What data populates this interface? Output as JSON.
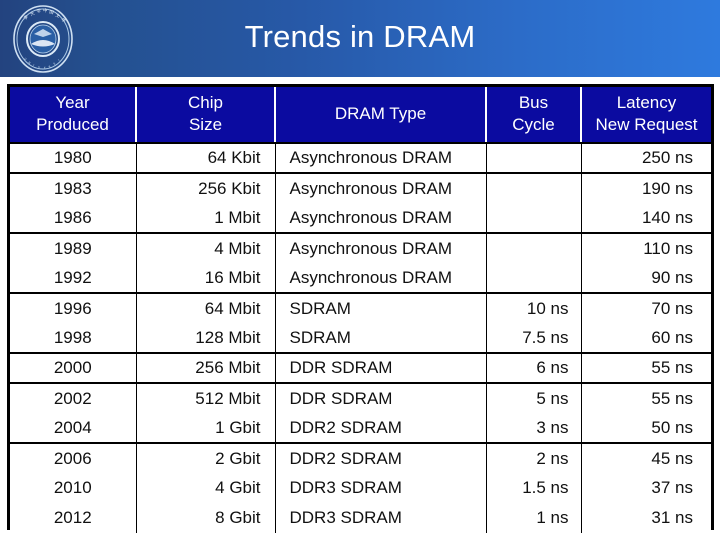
{
  "slide": {
    "title": "Trends in DRAM",
    "logo_name": "university-seal-logo",
    "banner_color_left": "#23437f",
    "banner_color_right": "#2e7ade",
    "table_header_color": "#0b0ba0"
  },
  "table": {
    "columns": [
      {
        "id": "year",
        "line1": "Year",
        "line2": "Produced"
      },
      {
        "id": "chip",
        "line1": "Chip",
        "line2": "Size"
      },
      {
        "id": "type",
        "line1": "DRAM Type",
        "line2": ""
      },
      {
        "id": "bus",
        "line1": "Bus",
        "line2": "Cycle"
      },
      {
        "id": "latency",
        "line1": "Latency",
        "line2": "New Request"
      }
    ],
    "rows": [
      {
        "year": "1980",
        "chip": "64 Kbit",
        "type": "Asynchronous DRAM",
        "bus": "",
        "latency": "250 ns",
        "rule": "strong"
      },
      {
        "year": "1983",
        "chip": "256 Kbit",
        "type": "Asynchronous DRAM",
        "bus": "",
        "latency": "190 ns",
        "rule": "thin"
      },
      {
        "year": "1986",
        "chip": "1 Mbit",
        "type": "Asynchronous DRAM",
        "bus": "",
        "latency": "140 ns",
        "rule": "strong"
      },
      {
        "year": "1989",
        "chip": "4 Mbit",
        "type": "Asynchronous DRAM",
        "bus": "",
        "latency": "110 ns",
        "rule": "none"
      },
      {
        "year": "1992",
        "chip": "16 Mbit",
        "type": "Asynchronous DRAM",
        "bus": "",
        "latency": "90 ns",
        "rule": "strong"
      },
      {
        "year": "1996",
        "chip": "64 Mbit",
        "type": "SDRAM",
        "bus": "10 ns",
        "latency": "70 ns",
        "rule": "none"
      },
      {
        "year": "1998",
        "chip": "128 Mbit",
        "type": "SDRAM",
        "bus": "7.5 ns",
        "latency": "60 ns",
        "rule": "strong"
      },
      {
        "year": "2000",
        "chip": "256 Mbit",
        "type": "DDR SDRAM",
        "bus": "6 ns",
        "latency": "55 ns",
        "rule": "strong"
      },
      {
        "year": "2002",
        "chip": "512 Mbit",
        "type": "DDR SDRAM",
        "bus": "5 ns",
        "latency": "55 ns",
        "rule": "none"
      },
      {
        "year": "2004",
        "chip": "1 Gbit",
        "type": "DDR2 SDRAM",
        "bus": "3 ns",
        "latency": "50 ns",
        "rule": "strong"
      },
      {
        "year": "2006",
        "chip": "2 Gbit",
        "type": "DDR2 SDRAM",
        "bus": "2 ns",
        "latency": "45 ns",
        "rule": "thin"
      },
      {
        "year": "2010",
        "chip": "4 Gbit",
        "type": "DDR3 SDRAM",
        "bus": "1.5 ns",
        "latency": "37 ns",
        "rule": "thin"
      },
      {
        "year": "2012",
        "chip": "8 Gbit",
        "type": "DDR3 SDRAM",
        "bus": "1 ns",
        "latency": "31 ns",
        "rule": "last"
      }
    ]
  }
}
